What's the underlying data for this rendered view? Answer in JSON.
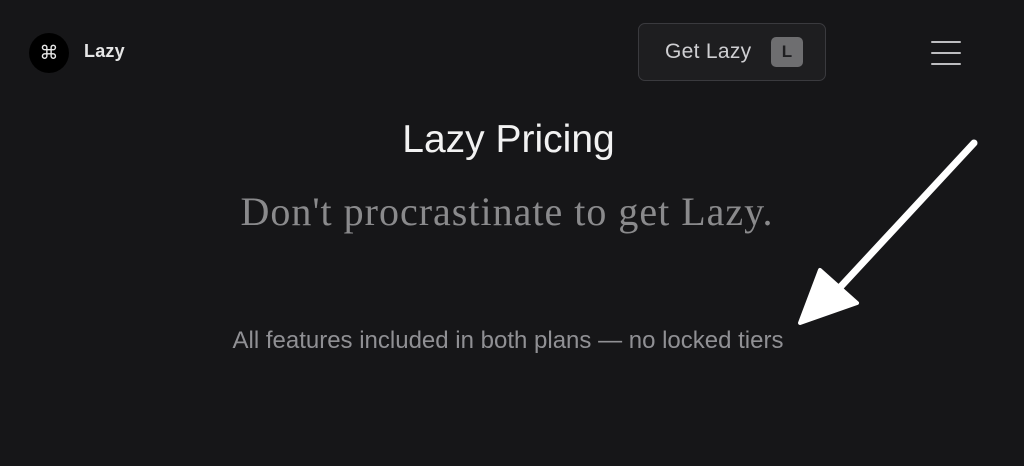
{
  "header": {
    "logo_glyph": "⌘",
    "brand_name": "Lazy",
    "cta": {
      "label": "Get Lazy",
      "shortcut": "L"
    },
    "menu_icon": "hamburger-menu-icon"
  },
  "hero": {
    "title": "Lazy Pricing",
    "tagline": "Don't procrastinate to get Lazy.",
    "features_note": "All features included in both plans — no locked tiers"
  },
  "annotation": {
    "icon": "arrow-pointer-icon",
    "color": "#ffffff"
  },
  "colors": {
    "background": "#161618",
    "button_background": "#1e1e20",
    "button_border": "#3a3a3e",
    "shortcut_badge": "#6e6e70",
    "title_text": "#f2f2f2",
    "tagline_text": "#8a8a8c",
    "note_text": "#909094"
  }
}
